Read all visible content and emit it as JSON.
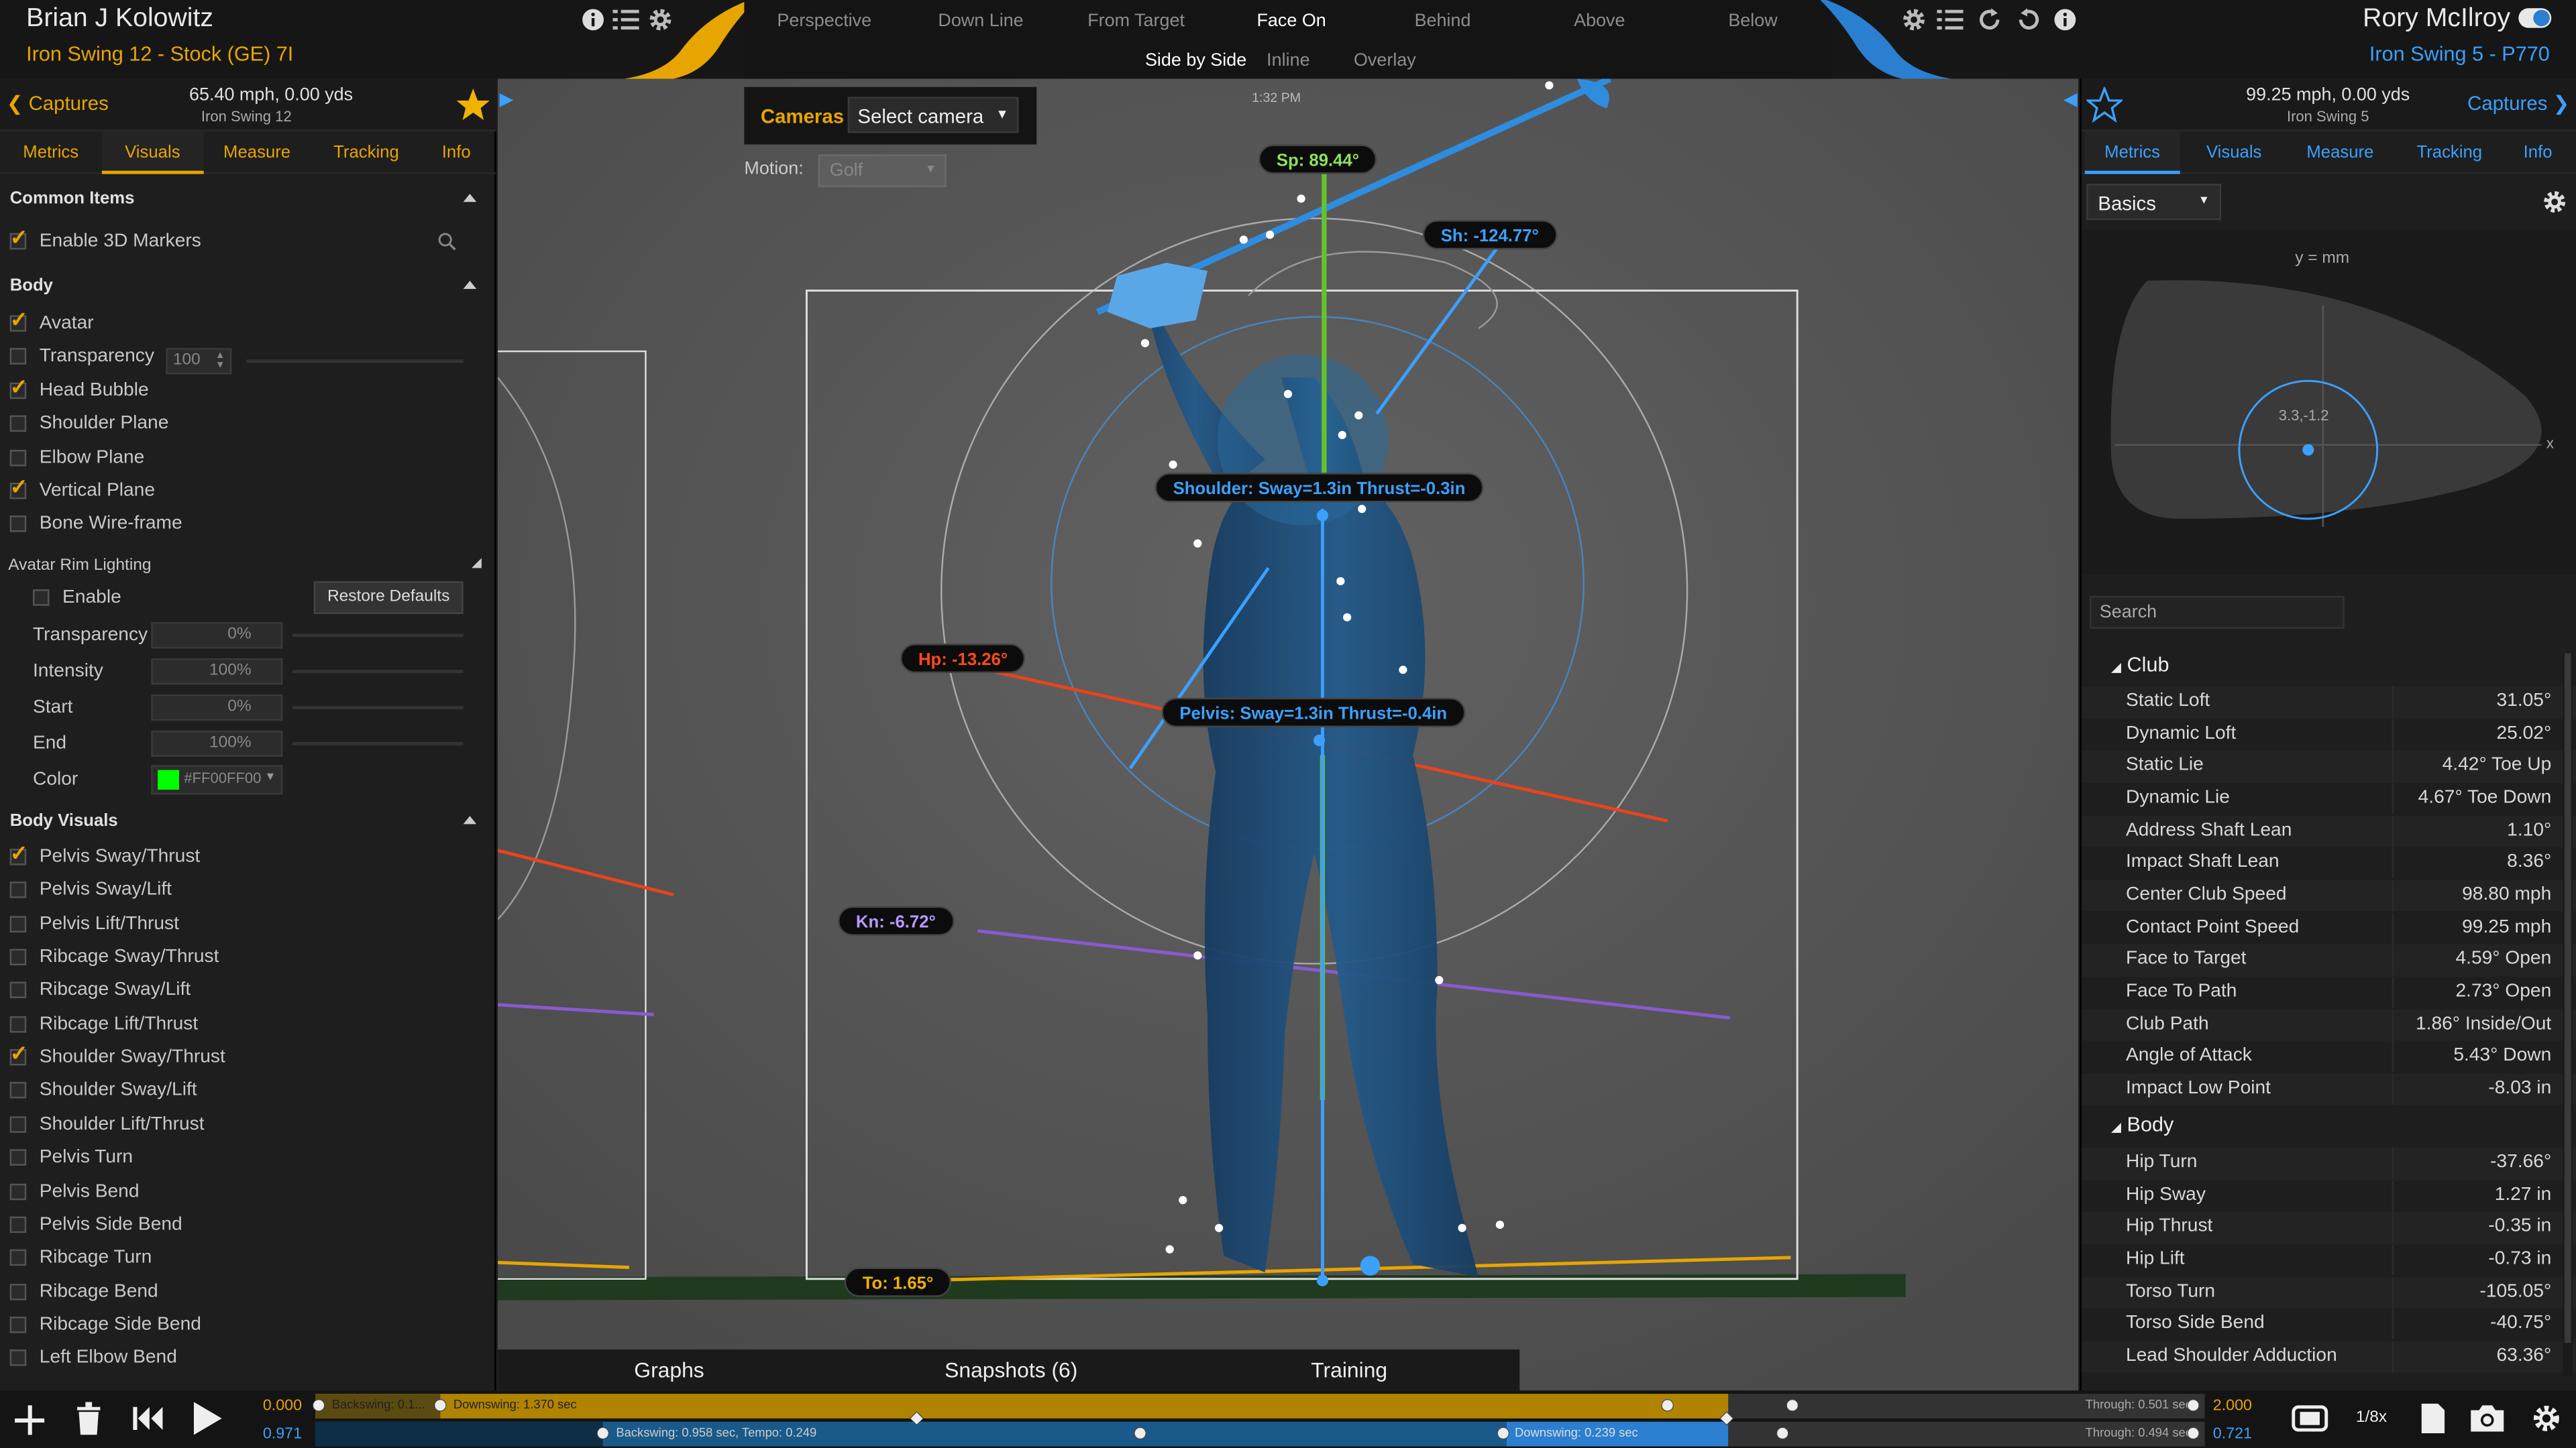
{
  "header": {
    "left_player": {
      "name": "Brian J Kolowitz",
      "swing": "Iron Swing 12 - Stock (GE) 7I"
    },
    "right_player": {
      "name": "Rory McIlroy",
      "swing": "Iron Swing 5 - P770"
    },
    "view_tabs": [
      "Perspective",
      "Down Line",
      "From Target",
      "Face On",
      "Behind",
      "Above",
      "Below"
    ],
    "active_view": "Face On",
    "compare_modes": [
      "Side by Side",
      "Inline",
      "Overlay"
    ],
    "active_mode": "Side by Side"
  },
  "left_panel": {
    "captures_label": "Captures",
    "speed": "65.40 mph, 0.00 yds",
    "swing_name": "Iron Swing 12",
    "tabs": [
      "Metrics",
      "Visuals",
      "Measure",
      "Tracking",
      "Info"
    ],
    "active_tab": "Visuals",
    "common_items_title": "Common Items",
    "enable_3d_markers": "Enable 3D Markers",
    "body_title": "Body",
    "body_items": [
      {
        "label": "Avatar",
        "checked": true
      },
      {
        "label": "Transparency",
        "checked": false
      },
      {
        "label": "Head Bubble",
        "checked": true
      },
      {
        "label": "Shoulder Plane",
        "checked": false
      },
      {
        "label": "Elbow Plane",
        "checked": false
      },
      {
        "label": "Vertical Plane",
        "checked": true
      },
      {
        "label": "Bone Wire-frame",
        "checked": false
      }
    ],
    "transparency_value": "100",
    "rim_title": "Avatar Rim Lighting",
    "rim_enable": "Enable",
    "restore_defaults": "Restore Defaults",
    "rim_fields": [
      {
        "label": "Transparency",
        "value": "0%"
      },
      {
        "label": "Intensity",
        "value": "100%"
      },
      {
        "label": "Start",
        "value": "0%"
      },
      {
        "label": "End",
        "value": "100%"
      }
    ],
    "color_label": "Color",
    "color_value": "#FF00FF00",
    "color_swatch": "#00ff00",
    "body_visuals_title": "Body Visuals",
    "body_visuals": [
      {
        "label": "Pelvis Sway/Thrust",
        "checked": true
      },
      {
        "label": "Pelvis Sway/Lift",
        "checked": false
      },
      {
        "label": "Pelvis Lift/Thrust",
        "checked": false
      },
      {
        "label": "Ribcage Sway/Thrust",
        "checked": false
      },
      {
        "label": "Ribcage Sway/Lift",
        "checked": false
      },
      {
        "label": "Ribcage Lift/Thrust",
        "checked": false
      },
      {
        "label": "Shoulder Sway/Thrust",
        "checked": true
      },
      {
        "label": "Shoulder Sway/Lift",
        "checked": false
      },
      {
        "label": "Shoulder Lift/Thrust",
        "checked": false
      },
      {
        "label": "Pelvis Turn",
        "checked": false
      },
      {
        "label": "Pelvis Bend",
        "checked": false
      },
      {
        "label": "Pelvis Side Bend",
        "checked": false
      },
      {
        "label": "Ribcage Turn",
        "checked": false
      },
      {
        "label": "Ribcage Bend",
        "checked": false
      },
      {
        "label": "Ribcage Side Bend",
        "checked": false
      },
      {
        "label": "Left Elbow Bend",
        "checked": false
      }
    ]
  },
  "viewport": {
    "cameras_label": "Cameras",
    "camera_select": "Select camera",
    "time": "1:32 PM",
    "motion_label": "Motion:",
    "motion_value": "Golf",
    "labels": {
      "spine": "Sp: 89.44°",
      "shoulder_angle": "Sh: -124.77°",
      "shoulder_sway": "Shoulder: Sway=1.3in Thrust=-0.3in",
      "hip": "Hp: -13.26°",
      "pelvis_sway": "Pelvis: Sway=1.3in Thrust=-0.4in",
      "knee": "Kn: -6.72°",
      "toe": "To: 1.65°"
    },
    "bottom_tabs": [
      "Graphs",
      "Snapshots (6)",
      "Training"
    ]
  },
  "right_panel": {
    "speed": "99.25 mph, 0.00 yds",
    "swing_name": "Iron Swing 5",
    "captures_label": "Captures",
    "tabs": [
      "Metrics",
      "Visuals",
      "Measure",
      "Tracking",
      "Info"
    ],
    "active_tab": "Metrics",
    "preset": "Basics",
    "face_chart": {
      "ylabel": "y = mm",
      "xlabel": "x",
      "impact_label": "3.3,-1.2"
    },
    "search_placeholder": "Search",
    "club_title": "Club",
    "club_metrics": [
      {
        "name": "Static Loft",
        "value": "31.05°"
      },
      {
        "name": "Dynamic Loft",
        "value": "25.02°"
      },
      {
        "name": "Static Lie",
        "value": "4.42° Toe Up"
      },
      {
        "name": "Dynamic Lie",
        "value": "4.67° Toe Down"
      },
      {
        "name": "Address Shaft Lean",
        "value": "1.10°"
      },
      {
        "name": "Impact Shaft Lean",
        "value": "8.36°"
      },
      {
        "name": "Center Club Speed",
        "value": "98.80 mph"
      },
      {
        "name": "Contact Point Speed",
        "value": "99.25 mph"
      },
      {
        "name": "Face to Target",
        "value": "4.59° Open"
      },
      {
        "name": "Face To Path",
        "value": "2.73° Open"
      },
      {
        "name": "Club Path",
        "value": "1.86° Inside/Out"
      },
      {
        "name": "Angle of Attack",
        "value": "5.43° Down"
      },
      {
        "name": "Impact Low Point",
        "value": "-8.03 in"
      }
    ],
    "body_title": "Body",
    "body_metrics": [
      {
        "name": "Hip Turn",
        "value": "-37.66°"
      },
      {
        "name": "Hip Sway",
        "value": "1.27 in"
      },
      {
        "name": "Hip Thrust",
        "value": "-0.35 in"
      },
      {
        "name": "Hip Lift",
        "value": "-0.73 in"
      },
      {
        "name": "Torso Turn",
        "value": "-105.05°"
      },
      {
        "name": "Torso Side Bend",
        "value": "-40.75°"
      },
      {
        "name": "Lead Shoulder Adduction",
        "value": "63.36°"
      }
    ]
  },
  "timeline": {
    "start_top": "0.000",
    "start_bottom": "0.971",
    "end_top": "2.000",
    "end_bottom": "0.721",
    "top_segments": {
      "backswing": "Backswing: 0.1...",
      "downswing": "Downswing: 1.370 sec",
      "through": "Through: 0.501 sec"
    },
    "bottom_segments": {
      "backswing": "Backswing: 0.958 sec, Tempo: 0.249",
      "downswing": "Downswing: 0.239 sec",
      "through": "Through: 0.494 sec"
    },
    "speed": "1/8x"
  },
  "colors": {
    "accent_yellow": "#e8a500",
    "accent_blue": "#3ba0ff",
    "avatar_blue": "#1d4f7e"
  }
}
